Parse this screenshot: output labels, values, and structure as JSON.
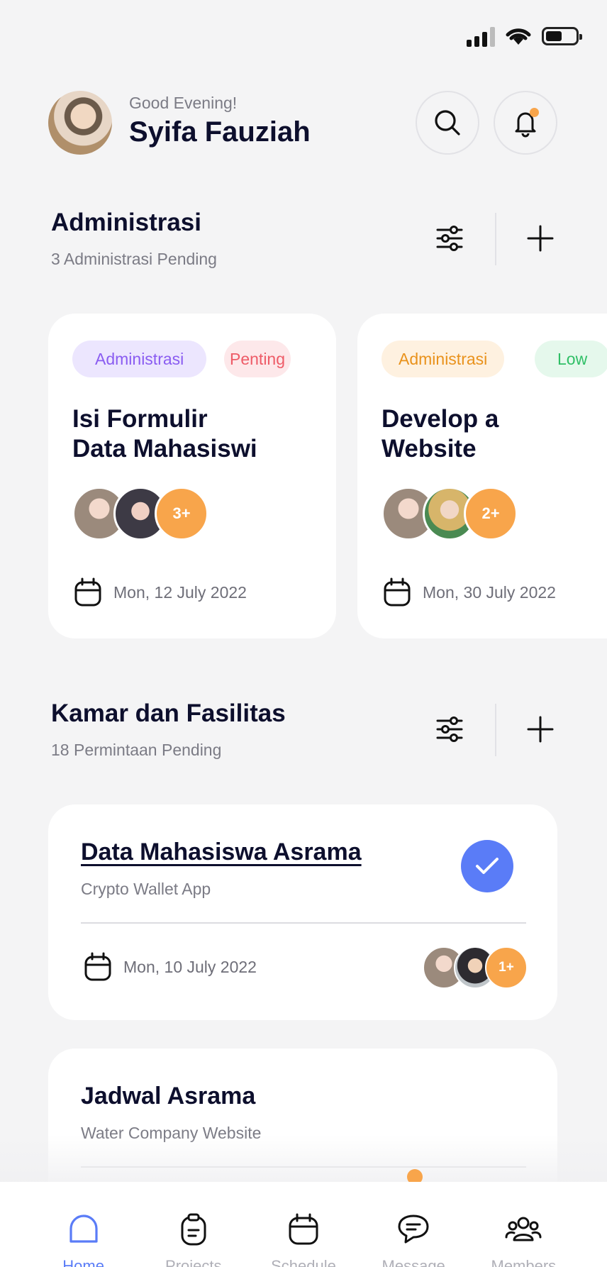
{
  "header": {
    "greeting": "Good Evening!",
    "user_name": "Syifa Fauziah"
  },
  "administrasi": {
    "title": "Administrasi",
    "subtitle": "3 Administrasi Pending",
    "cards": [
      {
        "tags": [
          "Administrasi",
          "Penting"
        ],
        "title_line1": "Isi Formulir",
        "title_line2": "Data Mahasiswi",
        "more_members": "3+",
        "date": "Mon, 12 July 2022"
      },
      {
        "tags": [
          "Administrasi",
          "Low"
        ],
        "title_line1": "Develop a",
        "title_line2": "Website",
        "more_members": "2+",
        "date": "Mon, 30 July 2022"
      }
    ]
  },
  "kamar": {
    "title": "Kamar dan Fasilitas",
    "subtitle": "18 Permintaan Pending",
    "items": [
      {
        "title": "Data Mahasiswa Asrama",
        "subtitle": "Crypto Wallet App",
        "date": "Mon, 10 July 2022",
        "more_members": "1+",
        "completed": true
      },
      {
        "title": "Jadwal Asrama",
        "subtitle": "Water Company Website"
      }
    ]
  },
  "bottom_nav": [
    {
      "label": "Home",
      "icon": "home-icon",
      "active": true
    },
    {
      "label": "Projects",
      "icon": "clipboard-icon",
      "active": false
    },
    {
      "label": "Schedule",
      "icon": "calendar-icon",
      "active": false
    },
    {
      "label": "Message",
      "icon": "chat-icon",
      "active": false
    },
    {
      "label": "Members",
      "icon": "users-icon",
      "active": false
    }
  ],
  "colors": {
    "accent_blue": "#5a7cf7",
    "accent_orange": "#f8a54b",
    "purple_chip": "#ece6fe",
    "red_chip": "#fde8ea",
    "orange_chip": "#fef1e0",
    "green_chip": "#e5f8ec"
  }
}
